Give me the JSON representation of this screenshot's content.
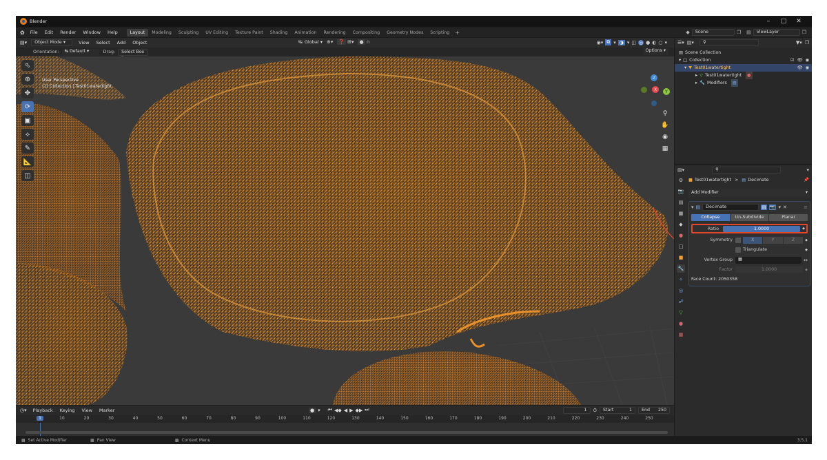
{
  "window": {
    "title": "Blender"
  },
  "menu": [
    "File",
    "Edit",
    "Render",
    "Window",
    "Help"
  ],
  "workspaces": [
    {
      "label": "Layout",
      "active": true
    },
    {
      "label": "Modeling",
      "active": false
    },
    {
      "label": "Sculpting",
      "active": false
    },
    {
      "label": "UV Editing",
      "active": false
    },
    {
      "label": "Texture Paint",
      "active": false
    },
    {
      "label": "Shading",
      "active": false
    },
    {
      "label": "Animation",
      "active": false
    },
    {
      "label": "Rendering",
      "active": false
    },
    {
      "label": "Compositing",
      "active": false
    },
    {
      "label": "Geometry Nodes",
      "active": false
    },
    {
      "label": "Scripting",
      "active": false
    }
  ],
  "add_workspace": "+",
  "scene": "Scene",
  "view_layer": "ViewLayer",
  "viewport_header": {
    "mode": "Object Mode",
    "menus": [
      "View",
      "Select",
      "Add",
      "Object"
    ],
    "transform": "Global"
  },
  "tool_settings": {
    "orientation_label": "Orientation:",
    "orientation_value": "Default",
    "drag_label": "Drag:",
    "drag_value": "Select Box",
    "options": "Options"
  },
  "viewport": {
    "perspective": "User Perspective",
    "collection": "(1) Collection | Test01watertight",
    "axes": {
      "z": "Z",
      "x": "X",
      "y": "Y"
    }
  },
  "toolbar_icons": [
    "cursor-select-icon",
    "cursor-icon",
    "move-icon",
    "rotate-icon",
    "scale-icon",
    "transform-icon",
    "annotate-icon",
    "measure-icon",
    "add-cube-icon"
  ],
  "outliner": {
    "root": "Scene Collection",
    "collection": "Collection",
    "object": "Test01watertight",
    "mesh": "Test01watertight",
    "modifiers": "Modifiers"
  },
  "properties": {
    "breadcrumb_object": "Test01watertight",
    "breadcrumb_sep": ">",
    "breadcrumb_modifier": "Decimate",
    "add_modifier": "Add Modifier",
    "modifier_name": "Decimate",
    "modes": [
      {
        "label": "Collapse",
        "active": true
      },
      {
        "label": "Un-Subdivide",
        "active": false
      },
      {
        "label": "Planar",
        "active": false
      }
    ],
    "ratio_label": "Ratio",
    "ratio_value": "1.0000",
    "ratio_fill": 1.0,
    "symmetry_label": "Symmetry",
    "symmetry_axes": [
      "X",
      "Y",
      "Z"
    ],
    "triangulate": "Triangulate",
    "vertex_group_label": "Vertex Group",
    "factor_label": "Factor",
    "factor_value": "1.0000",
    "face_count": "Face Count: 2050358"
  },
  "timeline": {
    "menus": [
      "Playback",
      "Keying",
      "View",
      "Marker"
    ],
    "current_frame": "1",
    "start_label": "Start",
    "start_value": "1",
    "end_label": "End",
    "end_value": "250",
    "ticks": [
      "1",
      "10",
      "20",
      "30",
      "40",
      "50",
      "60",
      "70",
      "80",
      "90",
      "100",
      "110",
      "120",
      "130",
      "140",
      "150",
      "160",
      "170",
      "180",
      "190",
      "200",
      "210",
      "220",
      "230",
      "240",
      "250"
    ]
  },
  "status": {
    "left": "Set Active Modifier",
    "middle": "Pan View",
    "right": "Context Menu",
    "version": "3.5.1"
  },
  "colors": {
    "mesh": "#f0a030",
    "accent": "#4772b3",
    "highlight": "#e8462a",
    "axis_x": "#e5484d",
    "axis_y": "#8cc63f",
    "axis_z": "#3d8bd9"
  }
}
